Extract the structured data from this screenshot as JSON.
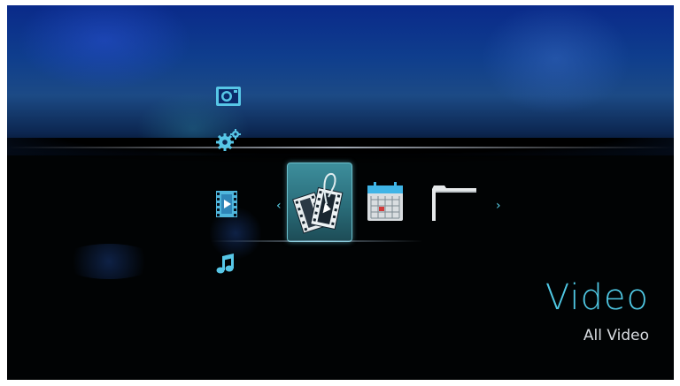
{
  "menu": {
    "side_icons": [
      "photo-icon",
      "settings-icon",
      "video-icon",
      "music-icon"
    ],
    "carousel_icons": [
      "video-clips-icon",
      "calendar-icon",
      "folder-icon"
    ],
    "selected_index": 0,
    "title": "Video",
    "subtitle": "All Video"
  },
  "colors": {
    "accent": "#4fc8e4",
    "subtitle": "#d9dde2",
    "background": "#010304",
    "sky": "#0f3e8d"
  }
}
